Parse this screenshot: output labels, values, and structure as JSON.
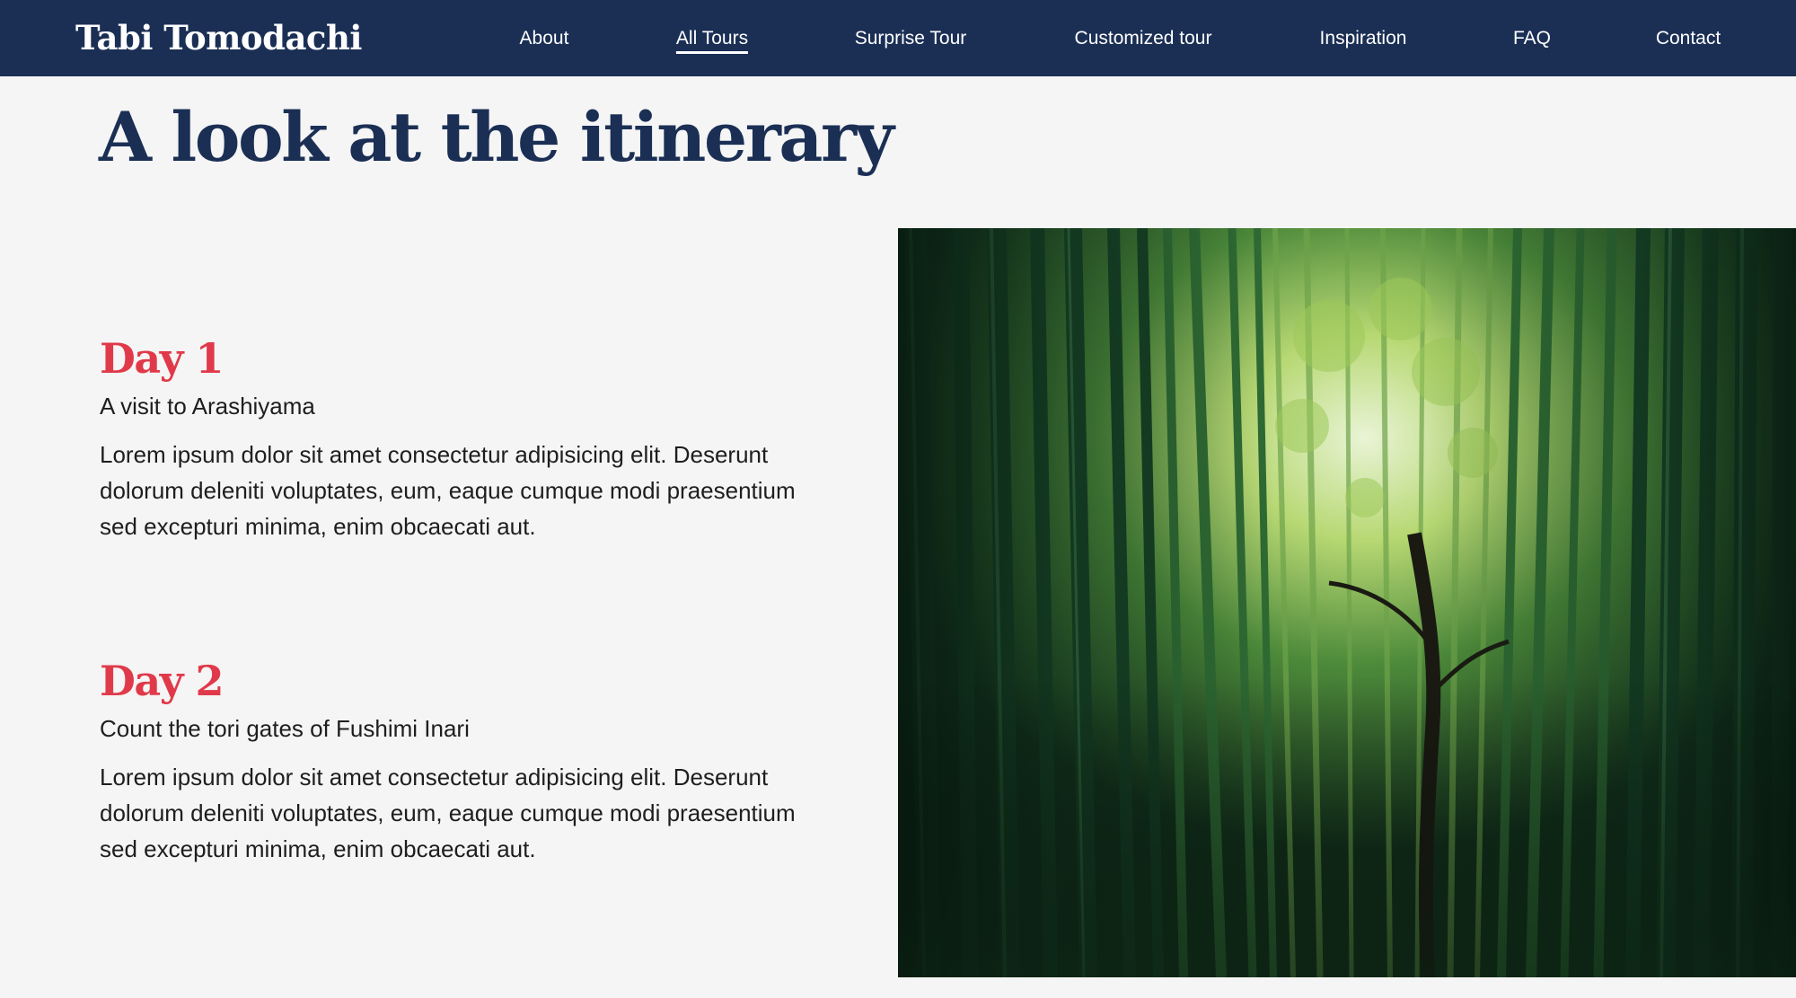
{
  "brand": {
    "name": "Tabi Tomodachi"
  },
  "nav": {
    "items": [
      {
        "label": "About",
        "active": false
      },
      {
        "label": "All Tours",
        "active": true
      },
      {
        "label": "Surprise Tour",
        "active": false
      },
      {
        "label": "Customized tour",
        "active": false
      },
      {
        "label": "Inspiration",
        "active": false
      },
      {
        "label": "FAQ",
        "active": false
      },
      {
        "label": "Contact",
        "active": false
      }
    ]
  },
  "page": {
    "title": "A look at the itinerary"
  },
  "itinerary": {
    "days": [
      {
        "heading": "Day 1",
        "subtitle": "A visit to Arashiyama",
        "text": "Lorem ipsum dolor sit amet consectetur adipisicing elit. Deserunt dolorum deleniti voluptates, eum, eaque cumque modi praesentium sed excepturi minima, enim obcaecati aut."
      },
      {
        "heading": "Day 2",
        "subtitle": "Count the tori gates of Fushimi Inari",
        "text": "Lorem ipsum dolor sit amet consectetur adipisicing elit. Deserunt dolorum deleniti voluptates, eum, eaque cumque modi praesentium sed excepturi minima, enim obcaecati aut."
      }
    ]
  },
  "colors": {
    "navbar": "#1b2f55",
    "title": "#1b2f55",
    "day_heading": "#e03a4a",
    "background": "#f5f5f5"
  }
}
